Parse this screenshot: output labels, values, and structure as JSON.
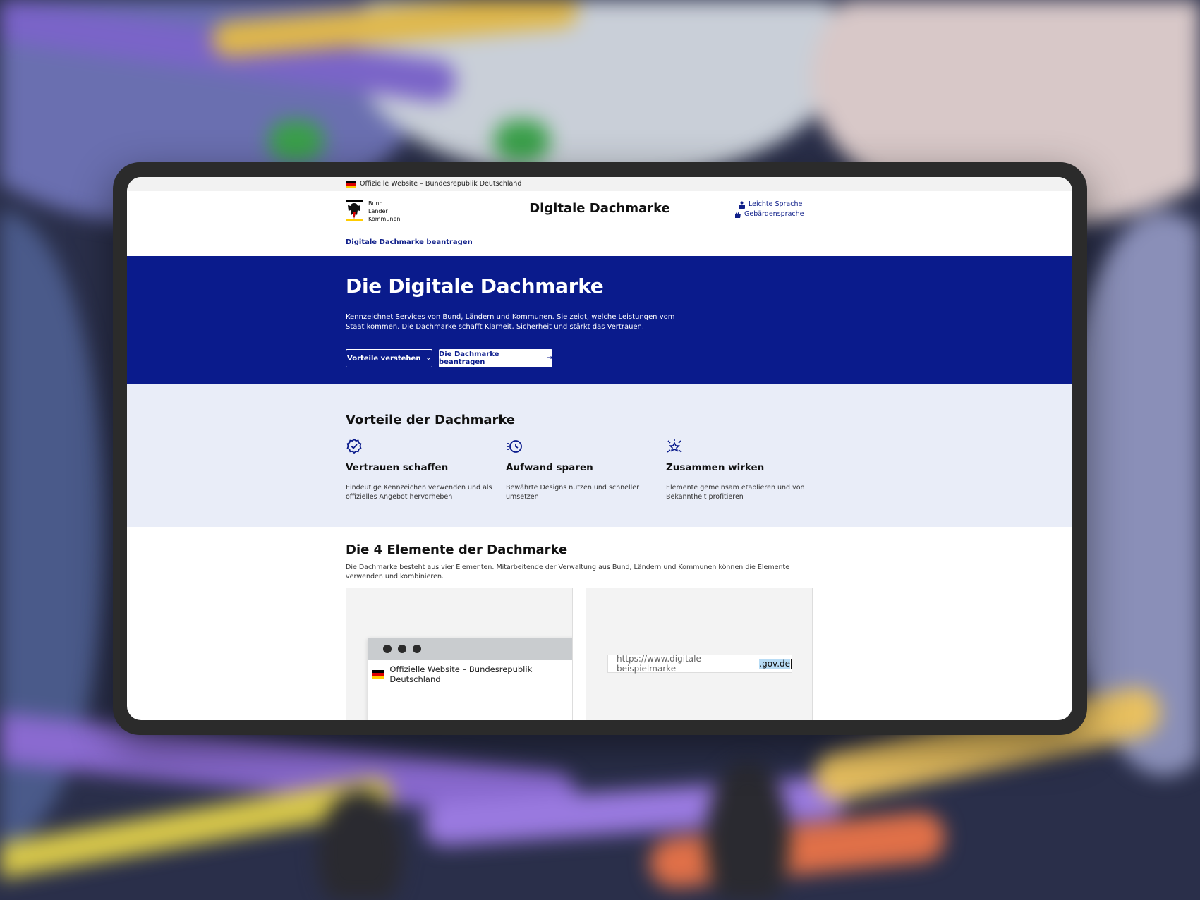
{
  "official_bar": {
    "text": "Offizielle Website – Bundesrepublik Deutschland"
  },
  "header": {
    "logo_lines": [
      "Bund",
      "Länder",
      "Kommunen"
    ],
    "title": "Digitale Dachmarke",
    "links": [
      {
        "label": "Leichte Sprache",
        "icon": "easy-language-icon"
      },
      {
        "label": "Gebärdensprache",
        "icon": "sign-language-icon"
      }
    ]
  },
  "nav": {
    "link_label": "Digitale Dachmarke beantragen"
  },
  "hero": {
    "title": "Die Digitale Dachmarke",
    "text": "Kennzeichnet Services von Bund, Ländern und Kommunen. Sie zeigt, welche Leistungen vom Staat kommen. Die Dachmarke schafft Klarheit, Sicherheit und stärkt das Vertrauen.",
    "button_primary": "Vorteile verstehen",
    "button_secondary": "Die Dachmarke beantragen"
  },
  "benefits": {
    "title": "Vorteile der Dachmarke",
    "items": [
      {
        "title": "Vertrauen schaffen",
        "text": "Eindeutige Kennzeichen verwenden und als offizielles Angebot hervorheben",
        "icon": "verified-badge-icon"
      },
      {
        "title": "Aufwand sparen",
        "text": "Bewährte Designs nutzen und schneller umsetzen",
        "icon": "clock-speed-icon"
      },
      {
        "title": "Zusammen wirken",
        "text": "Elemente gemeinsam etablieren und von Bekanntheit profitieren",
        "icon": "collaboration-icon"
      }
    ]
  },
  "elements": {
    "title": "Die 4 Elemente der Dachmarke",
    "text": "Die Dachmarke besteht aus vier Elementen. Mitarbeitende der Verwaltung aus Bund, Ländern und Kommunen können die Elemente verwenden und kombinieren.",
    "card1": {
      "window_bar_text": "Offizielle Website – Bundesrepublik Deutschland"
    },
    "card2": {
      "url_prefix": "https://www.digitale-beispielmarke",
      "url_highlight": ".gov.de"
    }
  },
  "colors": {
    "primary": "#0a1b8c",
    "benefits_bg": "#e9edf8",
    "frame": "#2b2b2b",
    "flag_black": "#000000",
    "flag_red": "#dd0000",
    "flag_gold": "#ffcc00"
  }
}
